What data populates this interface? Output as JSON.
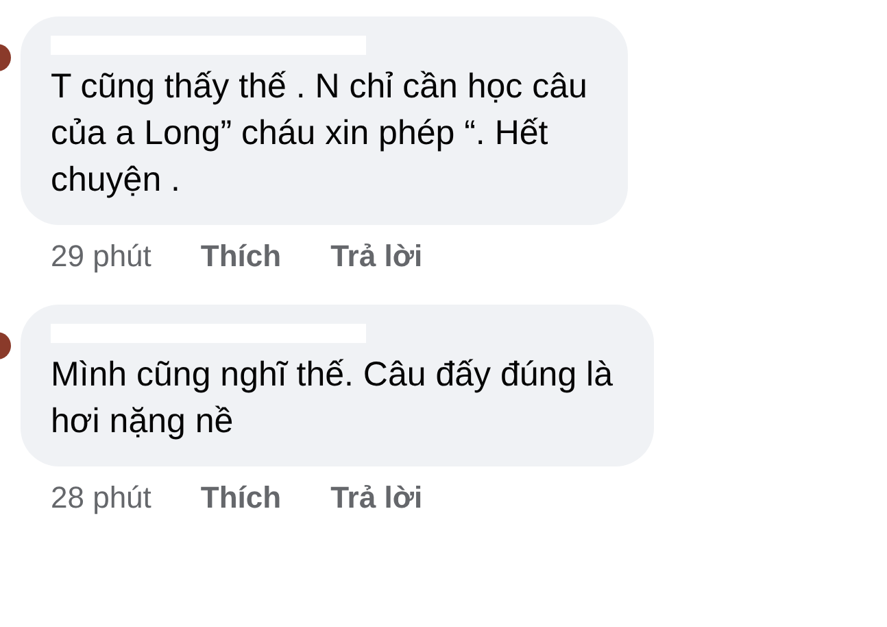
{
  "comments": [
    {
      "text": "T cũng thấy thế . N chỉ cần học câu\ncủa a Long” cháu xin phép “. Hết\nchuyện .",
      "time": "29 phút",
      "like": "Thích",
      "reply": "Trả lời"
    },
    {
      "text": "Mình cũng nghĩ thế. Câu đấy đúng là\nhơi nặng nề",
      "time": "28 phút",
      "like": "Thích",
      "reply": "Trả lời"
    }
  ]
}
